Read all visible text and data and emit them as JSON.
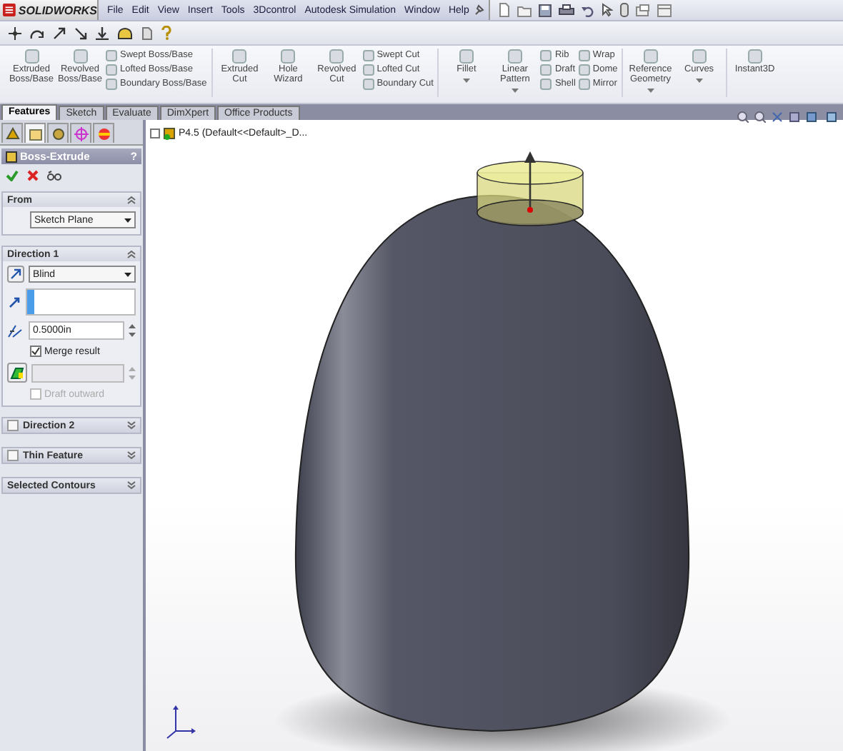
{
  "app": {
    "logo": "SOLIDWORKS"
  },
  "menu": [
    "File",
    "Edit",
    "View",
    "Insert",
    "Tools",
    "3Dcontrol",
    "Autodesk Simulation",
    "Window",
    "Help"
  ],
  "ribbon": [
    [
      {
        "kind": "large",
        "label": "Extruded Boss/Base"
      },
      {
        "kind": "large",
        "label": "Revolved Boss/Base"
      },
      {
        "kind": "stack",
        "items": [
          "Swept Boss/Base",
          "Lofted Boss/Base",
          "Boundary Boss/Base"
        ]
      }
    ],
    [
      {
        "kind": "large",
        "label": "Extruded Cut"
      },
      {
        "kind": "large",
        "label": "Hole Wizard"
      },
      {
        "kind": "large",
        "label": "Revolved Cut"
      },
      {
        "kind": "stack",
        "items": [
          "Swept Cut",
          "Lofted Cut",
          "Boundary Cut"
        ]
      }
    ],
    [
      {
        "kind": "large",
        "label": "Fillet",
        "dropdown": true
      },
      {
        "kind": "large",
        "label": "Linear Pattern",
        "dropdown": true
      },
      {
        "kind": "stack",
        "items": [
          "Rib",
          "Draft",
          "Shell"
        ]
      },
      {
        "kind": "stack",
        "items": [
          "Wrap",
          "Dome",
          "Mirror"
        ]
      }
    ],
    [
      {
        "kind": "large",
        "label": "Reference Geometry",
        "dropdown": true
      },
      {
        "kind": "large",
        "label": "Curves",
        "dropdown": true
      }
    ],
    [
      {
        "kind": "large",
        "label": "Instant3D"
      }
    ]
  ],
  "tabs": [
    {
      "label": "Features",
      "selected": true
    },
    {
      "label": "Sketch",
      "selected": false
    },
    {
      "label": "Evaluate",
      "selected": false
    },
    {
      "label": "DimXpert",
      "selected": false
    },
    {
      "label": "Office Products",
      "selected": false
    }
  ],
  "property_manager": {
    "icon_tabs": [
      {
        "selected": false
      },
      {
        "selected": true
      },
      {
        "selected": false
      },
      {
        "selected": false
      },
      {
        "selected": false
      }
    ],
    "title": "Boss-Extrude",
    "help": "?",
    "sections": [
      {
        "kind": "from",
        "title": "From",
        "expanded": true,
        "start": "Sketch Plane"
      },
      {
        "kind": "direction",
        "title": "Direction 1",
        "expanded": true,
        "end_condition": "Blind",
        "depth": "0.5000in",
        "merge_result": {
          "label": "Merge result",
          "checked": true,
          "disabled": false
        },
        "draft_outward": {
          "label": "Draft outward",
          "checked": false,
          "disabled": true
        }
      },
      {
        "kind": "option",
        "title": "Direction 2",
        "expanded": false,
        "checked": false
      },
      {
        "kind": "option",
        "title": "Thin Feature",
        "expanded": false,
        "checked": false
      },
      {
        "kind": "option",
        "title": "Selected Contours",
        "expanded": false
      }
    ]
  },
  "tree_root": "P4.5  (Default<<Default>_D..."
}
